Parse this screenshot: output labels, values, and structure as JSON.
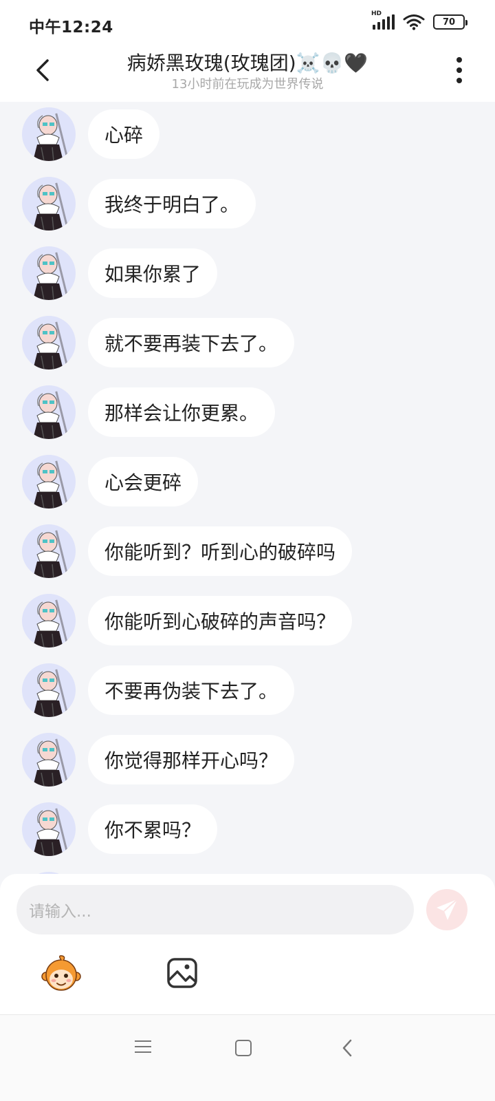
{
  "status_bar": {
    "time": "中午12:24",
    "network": "HD",
    "battery": "70"
  },
  "header": {
    "title": "病娇黑玫瑰(玫瑰团)☠️💀🖤",
    "subtitle": "13小时前在玩成为世界传说"
  },
  "messages": [
    {
      "text": "心碎"
    },
    {
      "text": "我终于明白了。"
    },
    {
      "text": "如果你累了"
    },
    {
      "text": "就不要再装下去了。"
    },
    {
      "text": "那样会让你更累。"
    },
    {
      "text": "心会更碎"
    },
    {
      "text": "你能听到？听到心的破碎吗"
    },
    {
      "text": "你能听到心破碎的声音吗？"
    },
    {
      "text": "不要再伪装下去了。"
    },
    {
      "text": "你觉得那样开心吗？"
    },
    {
      "text": "你不累吗？"
    }
  ],
  "input": {
    "placeholder": "请输入..."
  },
  "colors": {
    "chat_background": "#f4f5f8",
    "bubble": "#ffffff",
    "avatar_background": "#dfe3fa",
    "send_button": "#fbe4e4",
    "send_icon": "#ffffff"
  },
  "icons": {
    "back": "chevron-left-icon",
    "more": "more-vertical-icon",
    "send": "paper-plane-icon",
    "emoji": "monkey-face-icon",
    "image": "image-icon",
    "nav_menu": "menu-icon",
    "nav_home": "square-icon",
    "nav_back": "chevron-left-icon"
  }
}
